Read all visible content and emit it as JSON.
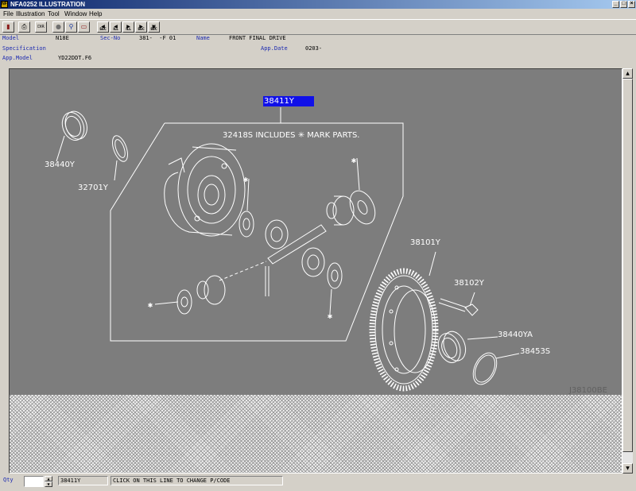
{
  "window": {
    "title": "NFA0252 ILLUSTRATION"
  },
  "menu": [
    "File",
    "Illustration",
    "Tool",
    "Window",
    "Help"
  ],
  "toolbar": {
    "buttons": [
      {
        "name": "book-icon",
        "glyph": "▮"
      },
      {
        "name": "print-icon",
        "glyph": "⎙"
      },
      {
        "name": "dir-icon",
        "glyph": "DIR"
      },
      {
        "name": "circle-icon",
        "glyph": "●"
      },
      {
        "name": "magnifier-icon",
        "glyph": "⚲"
      },
      {
        "name": "pages-icon",
        "glyph": "▭"
      },
      {
        "name": "sec-prev-icon",
        "glyph": "SEC"
      },
      {
        "name": "ill-prev-icon",
        "glyph": "ILL"
      },
      {
        "name": "ill-next-icon",
        "glyph": "ILL"
      },
      {
        "name": "sec-next-icon",
        "glyph": "SEC"
      },
      {
        "name": "sec-icon",
        "glyph": "SEC"
      }
    ]
  },
  "info": {
    "model_label": "Model",
    "model_value": "N18E",
    "secno_label": "Sec-No",
    "secno_value": "381-  -F 01",
    "name_label": "Name",
    "name_value": "FRONT FINAL DRIVE",
    "spec_label": "Specification",
    "appdate_label": "App.Date",
    "appdate_value": "0203-",
    "appmodel_label": "App.Model",
    "appmodel_value": "YD22DDT.F6"
  },
  "illustration": {
    "selected_part": "38411Y",
    "includes_note": "32418S INCLUDES ✳ MARK PARTS.",
    "callouts": [
      "38440Y",
      "32701Y",
      "38101Y",
      "38102Y",
      "38440YA",
      "38453S"
    ],
    "drawing_code": "J38100BE"
  },
  "status": {
    "qty_label": "Qty",
    "qty_value": "",
    "part_code": "38411Y",
    "hint": "CLICK ON THIS LINE TO CHANGE P/CODE"
  }
}
